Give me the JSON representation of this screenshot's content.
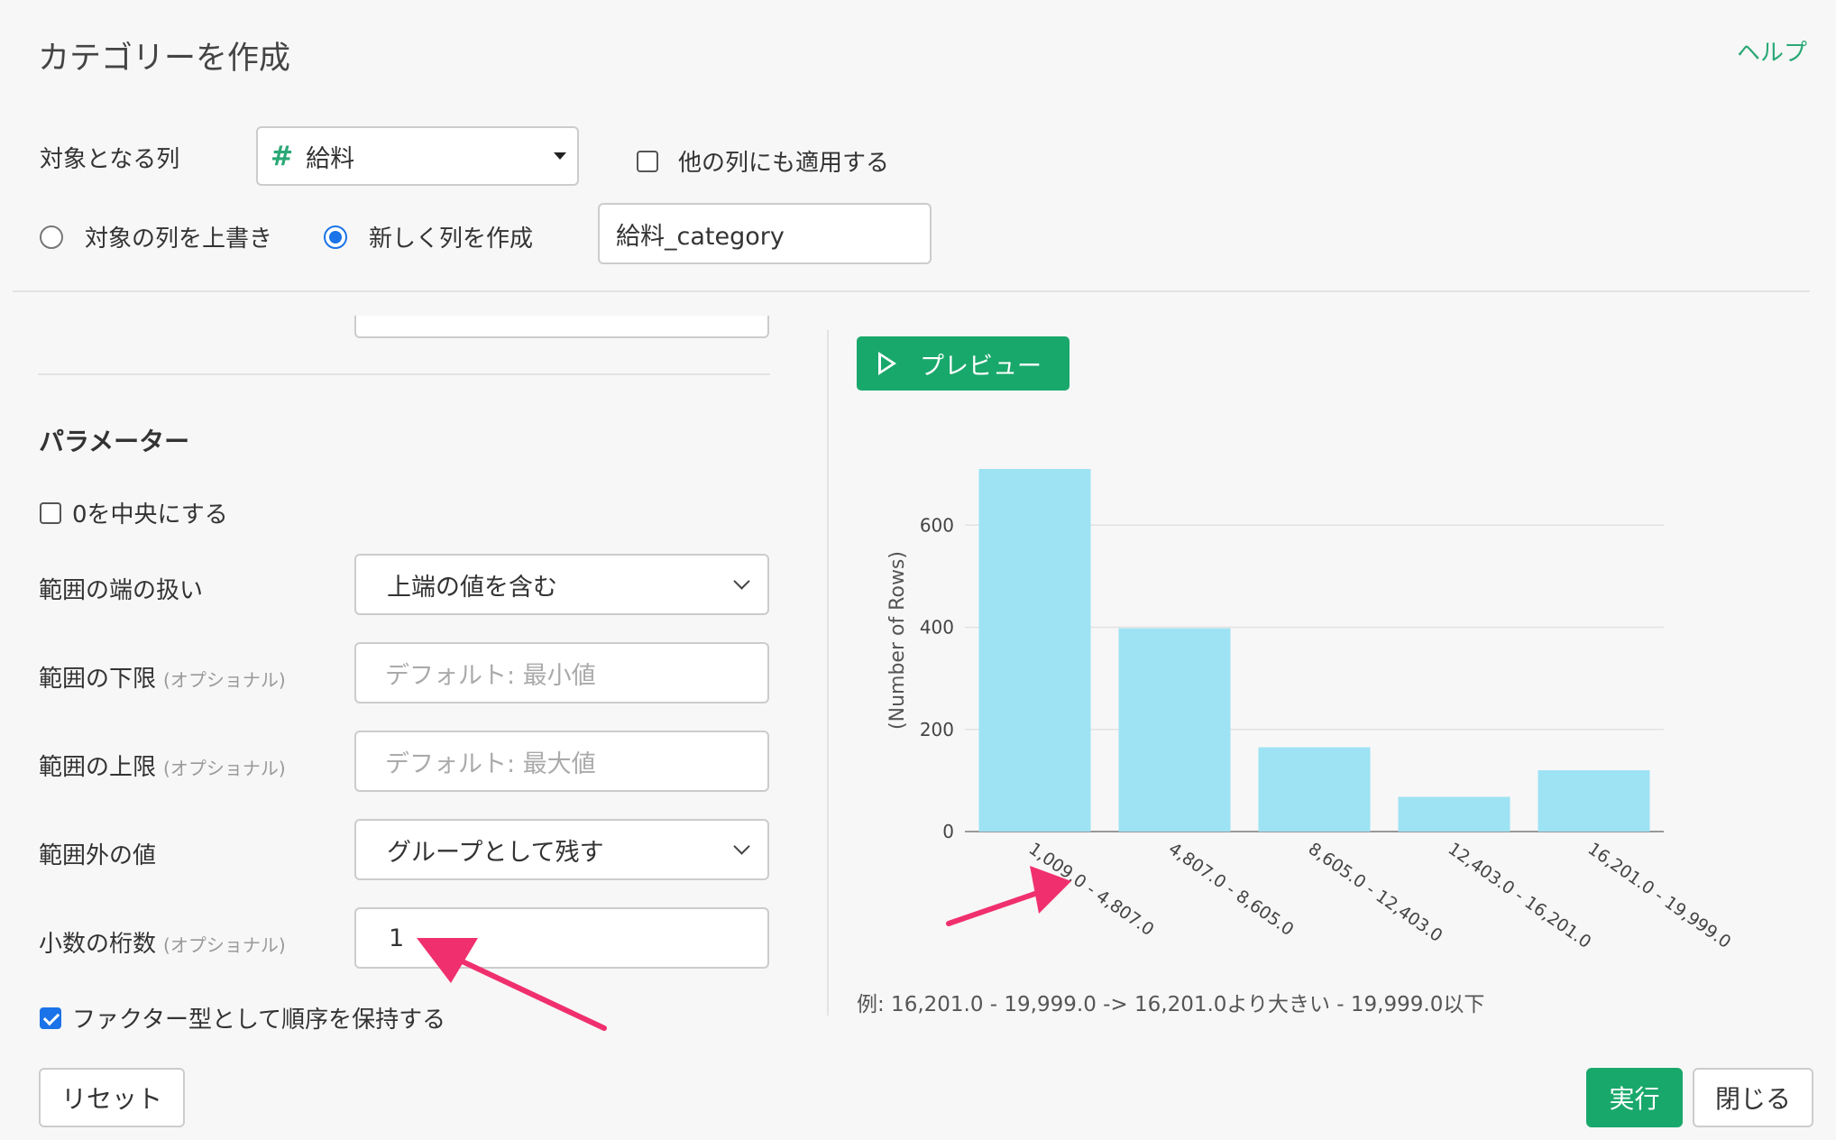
{
  "header": {
    "title": "カテゴリーを作成",
    "help": "ヘルプ"
  },
  "target": {
    "label": "対象となる列",
    "column_icon": "#",
    "column_value": "給料",
    "apply_other_label": "他の列にも適用する",
    "apply_other_checked": false
  },
  "output_mode": {
    "overwrite_label": "対象の列を上書き",
    "new_column_label": "新しく列を作成",
    "selected": "new_column",
    "new_column_name": "給料_category"
  },
  "params": {
    "section_title": "パラメーター",
    "center_zero_label": "0を中央にする",
    "center_zero_checked": false,
    "range_edge": {
      "label": "範囲の端の扱い",
      "value": "上端の値を含む"
    },
    "range_min": {
      "label": "範囲の下限",
      "optional": "(オプショナル)",
      "placeholder": "デフォルト: 最小値"
    },
    "range_max": {
      "label": "範囲の上限",
      "optional": "(オプショナル)",
      "placeholder": "デフォルト: 最大値"
    },
    "out_of_range": {
      "label": "範囲外の値",
      "value": "グループとして残す"
    },
    "decimals": {
      "label": "小数の桁数",
      "optional": "(オプショナル)",
      "value": "1"
    },
    "keep_order_label": "ファクター型として順序を保持する",
    "keep_order_checked": true
  },
  "preview": {
    "button_label": "プレビュー",
    "note": "例: 16,201.0 - 19,999.0 -> 16,201.0より大きい - 19,999.0以下"
  },
  "chart_data": {
    "type": "bar",
    "categories": [
      "1,009.0 - 4,807.0",
      "4,807.0 - 8,605.0",
      "8,605.0 - 12,403.0",
      "12,403.0 - 16,201.0",
      "16,201.0 - 19,999.0"
    ],
    "values": [
      710,
      398,
      165,
      68,
      120
    ],
    "ylabel": "(Number of Rows)",
    "yticks": [
      0,
      200,
      400,
      600
    ],
    "ylim": [
      0,
      710
    ],
    "bar_color": "#9de3f4",
    "grid": true
  },
  "annotations": {
    "arrow_color": "#f0306e"
  },
  "footer": {
    "reset": "リセット",
    "run": "実行",
    "close": "閉じる"
  }
}
